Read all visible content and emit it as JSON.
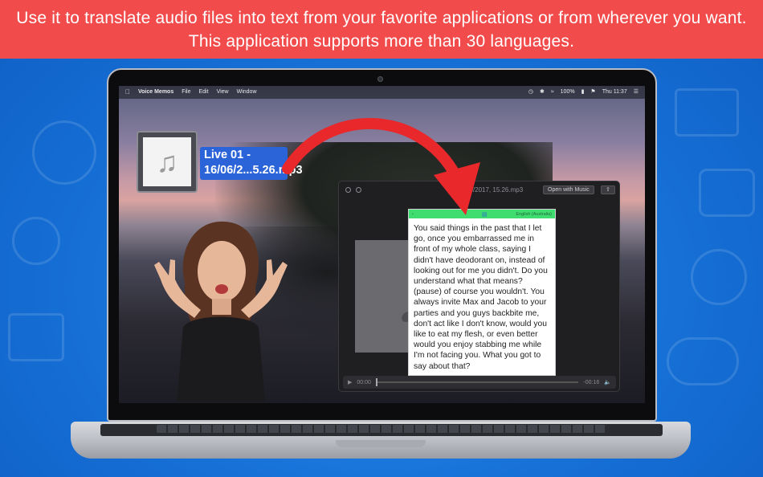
{
  "banner": {
    "line1": "Use it to translate audio files into text from your favorite applications or from wherever you want.",
    "line2": "This application supports more than 30 languages."
  },
  "menubar": {
    "apple_icon": "apple-icon",
    "app_name": "Voice Memos",
    "menus": [
      "File",
      "Edit",
      "View",
      "Window"
    ],
    "battery": "100%",
    "clock": "Thu 11:37"
  },
  "desktop_file": {
    "icon": "music-note-icon",
    "label_line1": "Live 01 -",
    "label_line2": "16/06/2...5.26.mp3"
  },
  "player": {
    "filename": "06/2017, 15.26.mp3",
    "open_with_button": "Open with Music",
    "share_icon": "share-icon",
    "elapsed": "00:00",
    "remaining": "-00:16"
  },
  "transcript": {
    "language": "English (Australia)",
    "body": "You said things in the past that I let go, once you embarrassed me in front of my whole class, saying I didn't have deodorant on, instead of looking out for me you didn't. Do you understand what that means? (pause) of course you wouldn't. You always invite Max and Jacob to your parties and you guys backbite me, don't act like I don't know, would you like to eat my flesh, or even better would you enjoy stabbing me while I'm not facing you. What you got to say about that?"
  },
  "colors": {
    "banner": "#f24b4b",
    "background": "#1a7ce0",
    "arrow": "#e8282b",
    "transcript_header": "#3fdc6f",
    "file_label": "#2a64d8"
  }
}
